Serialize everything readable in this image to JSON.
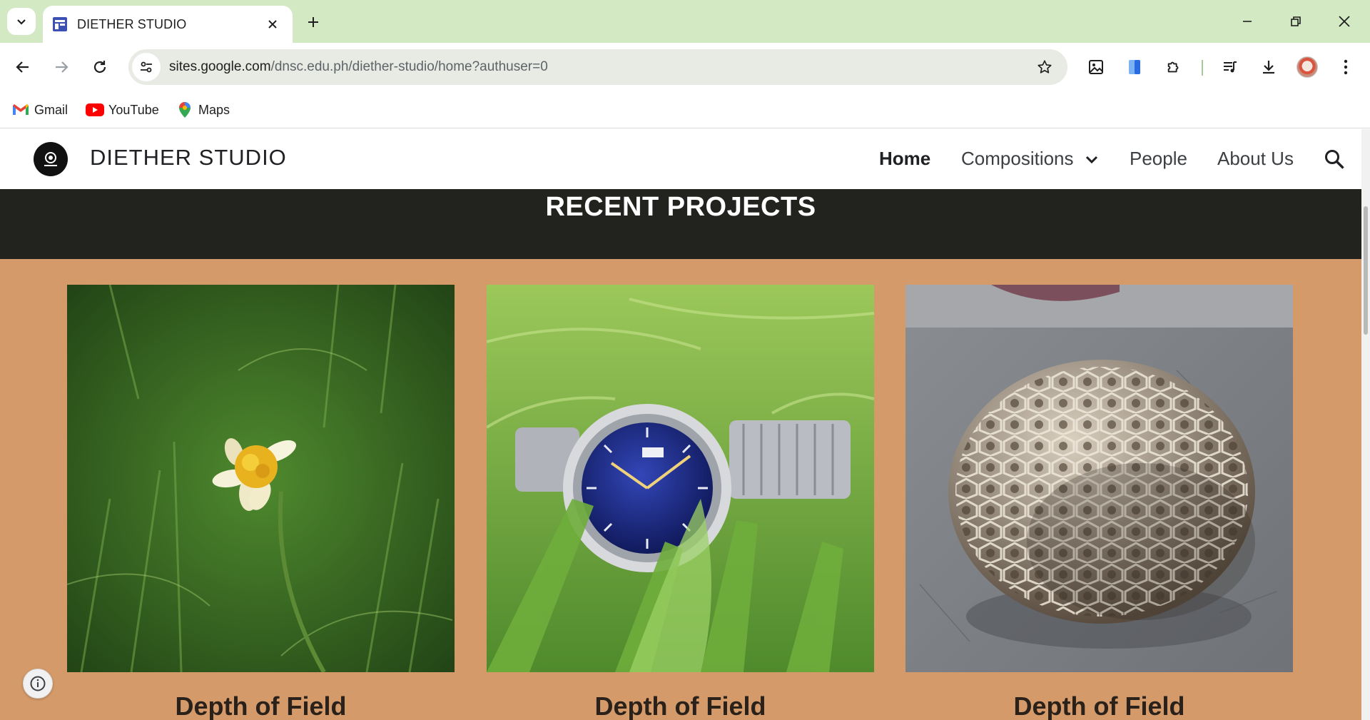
{
  "browser": {
    "tab": {
      "title": "DIETHER STUDIO"
    },
    "url": {
      "host": "sites.google.com",
      "path": "/dnsc.edu.ph/diether-studio/home?authuser=0"
    },
    "bookmarks": [
      {
        "label": "Gmail",
        "icon": "gmail-icon"
      },
      {
        "label": "YouTube",
        "icon": "youtube-icon"
      },
      {
        "label": "Maps",
        "icon": "maps-icon"
      }
    ],
    "accent": "#d3e9c4"
  },
  "site": {
    "title": "DIETHER STUDIO",
    "nav": {
      "home": "Home",
      "compositions": "Compositions",
      "people": "People",
      "about": "About Us"
    },
    "section_title": "RECENT PROJECTS",
    "cards": [
      {
        "caption": "Depth of Field",
        "image": "yellow-flower-in-grass-photo"
      },
      {
        "caption": "Depth of Field",
        "image": "wristwatch-in-grass-photo"
      },
      {
        "caption": "Depth of Field",
        "image": "coral-fossil-photo"
      }
    ],
    "colors": {
      "band": "#22231f",
      "background": "#d49a6a"
    }
  }
}
